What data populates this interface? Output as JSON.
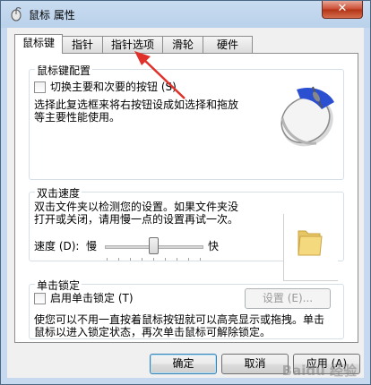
{
  "window": {
    "title": "鼠标 属性",
    "close_glyph": "✕"
  },
  "tabs": [
    "鼠标键",
    "指针",
    "指针选项",
    "滑轮",
    "硬件"
  ],
  "button_config": {
    "group_title": "鼠标键配置",
    "switch_label": "切换主要和次要的按钮 (S)",
    "description_line1": "选择此复选框来将右按钮设成如选择和拖放",
    "description_line2": "等主要性能使用。"
  },
  "double_click": {
    "group_title": "双击速度",
    "description_line1": "双击文件夹以检测您的设置。如果文件夹没",
    "description_line2": "打开或关闭，请用慢一点的设置再试一次。",
    "speed_label": "速度 (D):",
    "slow_label": "慢",
    "fast_label": "快",
    "speed_value": 0.5
  },
  "click_lock": {
    "group_title": "单击锁定",
    "enable_label": "启用单击锁定 (T)",
    "settings_button": "设置 (E)...",
    "description_line1": "使您可以不用一直按着鼠标按钮就可以高亮显示或拖拽。单击",
    "description_line2": "鼠标以进入锁定状态，再次单击鼠标可解除锁定。"
  },
  "footer": {
    "ok": "确定",
    "cancel": "取消",
    "apply": "应用 (A)"
  },
  "watermark": "Baidu 经验",
  "colors": {
    "annotation_arrow": "#e0302a",
    "title_bar": "#b9d1ea"
  }
}
